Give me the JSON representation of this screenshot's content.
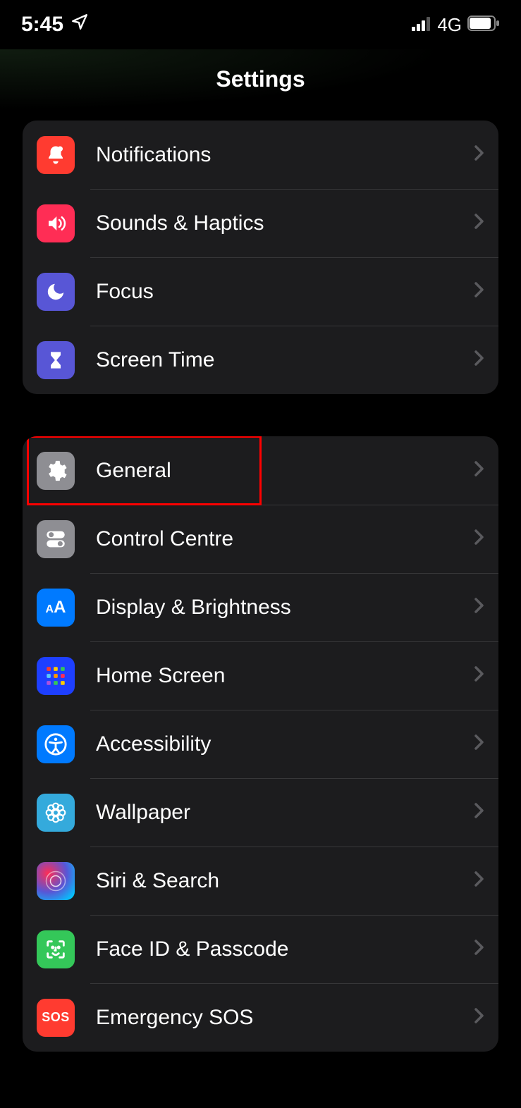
{
  "status": {
    "time": "5:45",
    "network": "4G"
  },
  "title": "Settings",
  "group1": [
    {
      "label": "Notifications"
    },
    {
      "label": "Sounds & Haptics"
    },
    {
      "label": "Focus"
    },
    {
      "label": "Screen Time"
    }
  ],
  "group2": [
    {
      "label": "General"
    },
    {
      "label": "Control Centre"
    },
    {
      "label": "Display & Brightness"
    },
    {
      "label": "Home Screen"
    },
    {
      "label": "Accessibility"
    },
    {
      "label": "Wallpaper"
    },
    {
      "label": "Siri & Search"
    },
    {
      "label": "Face ID & Passcode"
    },
    {
      "label": "Emergency SOS"
    }
  ]
}
